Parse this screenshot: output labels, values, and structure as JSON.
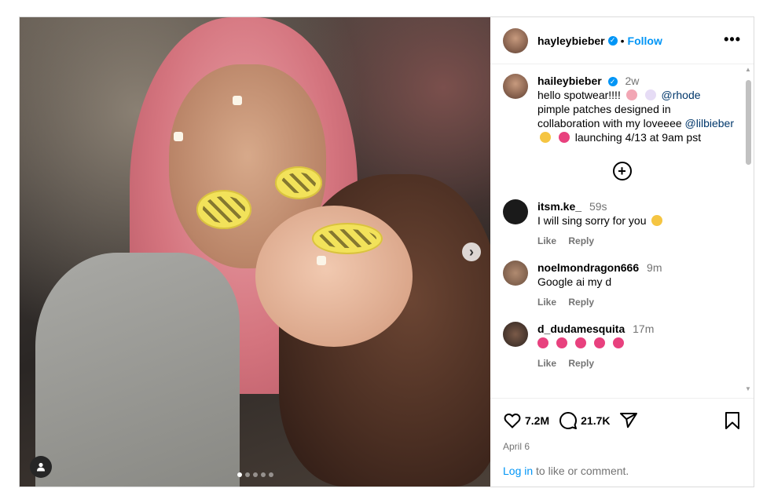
{
  "post": {
    "username": "hayleybieber",
    "follow_label": "Follow",
    "separator": "•",
    "more_label": "•••"
  },
  "caption": {
    "username": "haileybieber",
    "time": "2w",
    "line1": "hello spotwear!!!!",
    "mention1": "@rhode",
    "line2": "pimple patches designed in collaboration with my loveeee",
    "mention2": "@lilbieber",
    "line3": "launching 4/13 at 9am pst"
  },
  "comments": [
    {
      "username": "itsm.ke_",
      "time": "59s",
      "text": "I will sing sorry for you",
      "like": "Like",
      "reply": "Reply"
    },
    {
      "username": "noelmondragon666",
      "time": "9m",
      "text": "Google ai my d",
      "like": "Like",
      "reply": "Reply"
    },
    {
      "username": "d_dudamesquita",
      "time": "17m",
      "text": "",
      "like": "Like",
      "reply": "Reply"
    }
  ],
  "stats": {
    "likes": "7.2M",
    "comments": "21.7K",
    "date": "April 6"
  },
  "login": {
    "link": "Log in",
    "rest": " to like or comment."
  },
  "icons": {
    "like": "heart-icon",
    "comment": "comment-icon",
    "share": "share-icon",
    "save": "bookmark-icon",
    "add": "add-comment-icon",
    "next": "chevron-right-icon",
    "user": "user-icon"
  },
  "colors": {
    "accent": "#0095f6",
    "verified": "#0095f6",
    "muted": "#737373"
  }
}
